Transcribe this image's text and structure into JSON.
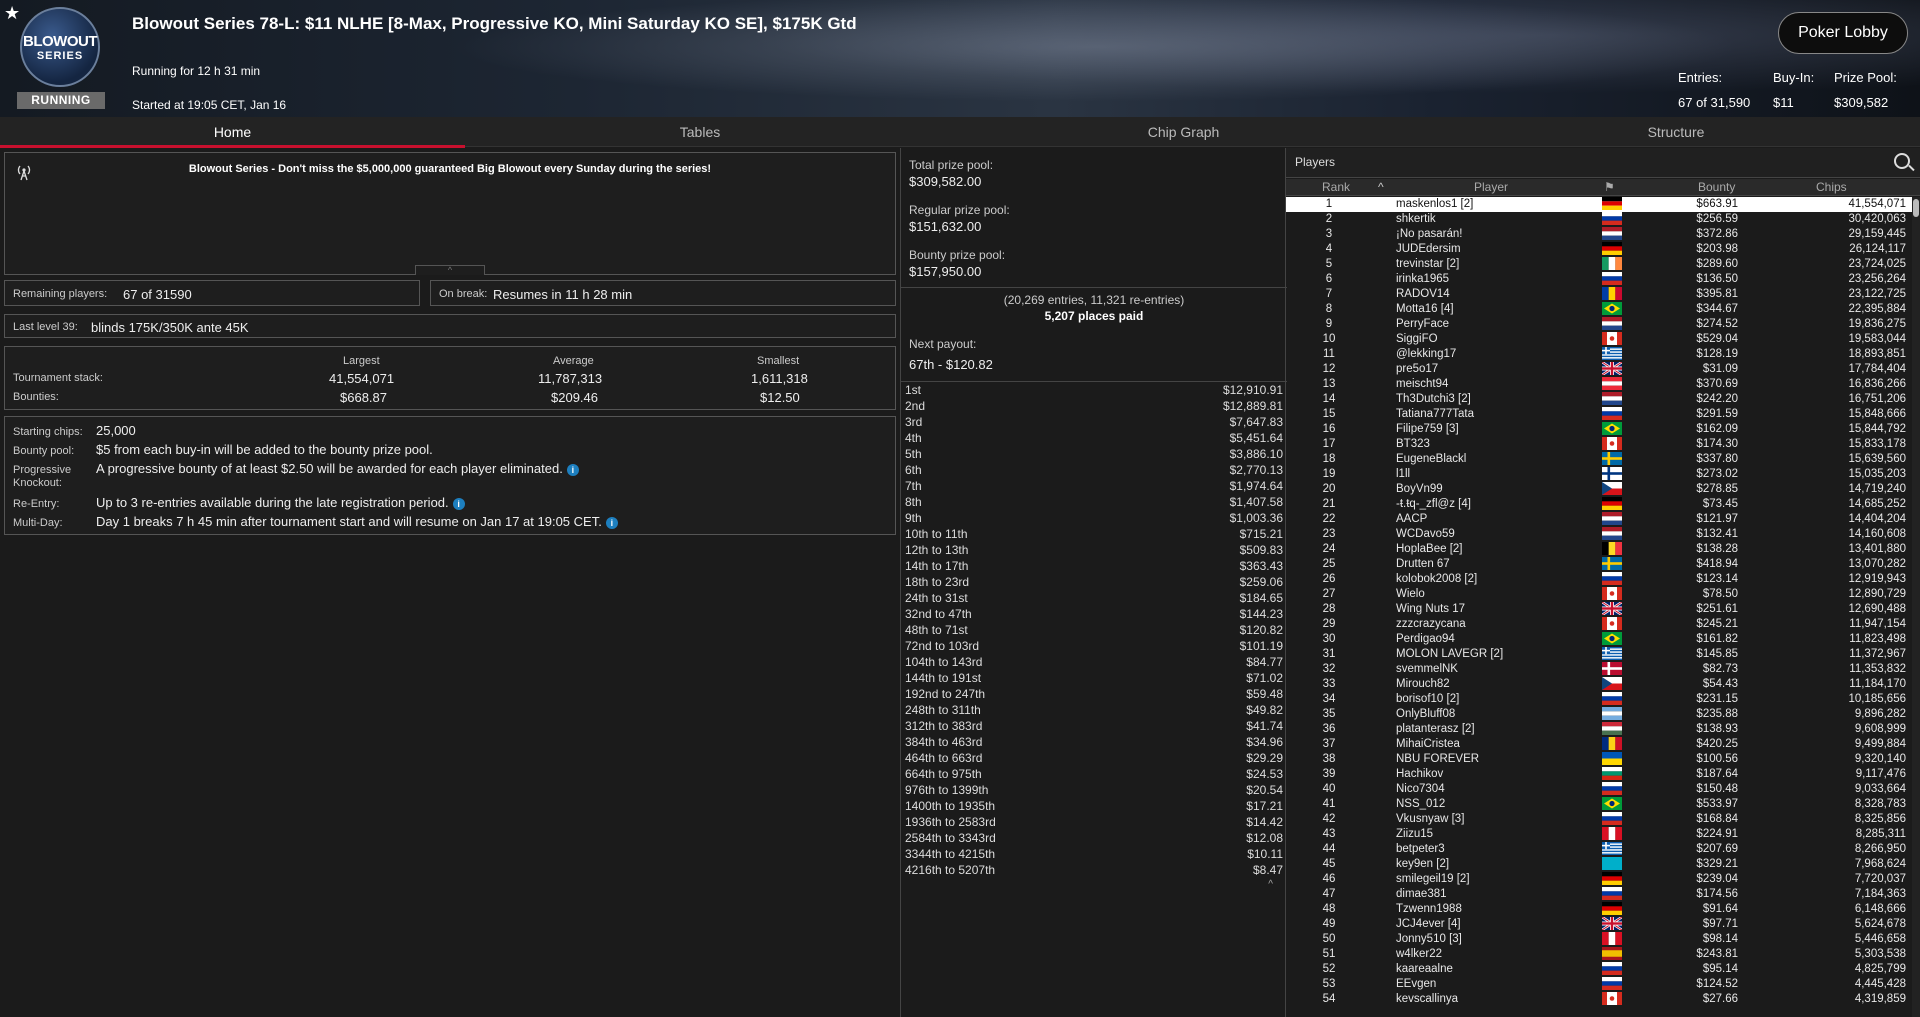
{
  "header": {
    "logo_line1": "BLOWOUT",
    "logo_line2": "SERIES",
    "status_badge": "RUNNING",
    "title": "Blowout Series 78-L: $11 NLHE [8-Max, Progressive KO, Mini Saturday KO SE], $175K Gtd",
    "running_for": "Running for 12 h 31 min",
    "started_at": "Started at 19:05 CET, Jan 16",
    "lobby_button": "Poker Lobby",
    "entries_label": "Entries:",
    "entries_value": "67 of 31,590",
    "buyin_label": "Buy-In:",
    "buyin_value": "$11",
    "prizepool_label": "Prize Pool:",
    "prizepool_value": "$309,582"
  },
  "tabs": [
    {
      "label": "Home"
    },
    {
      "label": "Tables"
    },
    {
      "label": "Chip Graph"
    },
    {
      "label": "Structure"
    }
  ],
  "home": {
    "announcement": "Blowout Series - Don't miss the $5,000,000 guaranteed Big Blowout every Sunday during the series!",
    "remaining_label": "Remaining players:",
    "remaining_value": "67 of 31590",
    "break_label": "On break:",
    "break_value": "Resumes in 11 h 28 min",
    "last_level_label": "Last level 39:",
    "last_level_value": "blinds 175K/350K ante 45K",
    "stack_headers": {
      "largest": "Largest",
      "average": "Average",
      "smallest": "Smallest"
    },
    "stack_label": "Tournament stack:",
    "stack_largest": "41,554,071",
    "stack_average": "11,787,313",
    "stack_smallest": "1,611,318",
    "bounties_label": "Bounties:",
    "bounty_largest": "$668.87",
    "bounty_average": "$209.46",
    "bounty_smallest": "$12.50",
    "info": {
      "starting_chips_label": "Starting chips:",
      "starting_chips": "25,000",
      "bounty_pool_label": "Bounty pool:",
      "bounty_pool": "$5 from each buy-in will be added to the bounty prize pool.",
      "pko_label1": "Progressive",
      "pko_label2": "Knockout:",
      "pko": "A progressive bounty of at least $2.50 will be awarded for each player eliminated.",
      "reentry_label": "Re-Entry:",
      "reentry": "Up to 3 re-entries available during the late registration period.",
      "multiday_label": "Multi-Day:",
      "multiday": "Day 1 breaks 7 h 45 min after tournament start and will resume on Jan 17 at 19:05 CET."
    }
  },
  "prizes": {
    "total_label": "Total prize pool:",
    "total_value": "$309,582.00",
    "regular_label": "Regular prize pool:",
    "regular_value": "$151,632.00",
    "bounty_label": "Bounty prize pool:",
    "bounty_value": "$157,950.00",
    "entries_note": "(20,269 entries, 11,321 re-entries)",
    "places_paid": "5,207 places paid",
    "next_payout_label": "Next payout:",
    "next_payout_value": "67th - $120.82",
    "payouts": [
      {
        "place": "1st",
        "amount": "$12,910.91"
      },
      {
        "place": "2nd",
        "amount": "$12,889.81"
      },
      {
        "place": "3rd",
        "amount": "$7,647.83"
      },
      {
        "place": "4th",
        "amount": "$5,451.64"
      },
      {
        "place": "5th",
        "amount": "$3,886.10"
      },
      {
        "place": "6th",
        "amount": "$2,770.13"
      },
      {
        "place": "7th",
        "amount": "$1,974.64"
      },
      {
        "place": "8th",
        "amount": "$1,407.58"
      },
      {
        "place": "9th",
        "amount": "$1,003.36"
      },
      {
        "place": "10th to 11th",
        "amount": "$715.21"
      },
      {
        "place": "12th to 13th",
        "amount": "$509.83"
      },
      {
        "place": "14th to 17th",
        "amount": "$363.43"
      },
      {
        "place": "18th to 23rd",
        "amount": "$259.06"
      },
      {
        "place": "24th to 31st",
        "amount": "$184.65"
      },
      {
        "place": "32nd to 47th",
        "amount": "$144.23"
      },
      {
        "place": "48th to 71st",
        "amount": "$120.82"
      },
      {
        "place": "72nd to 103rd",
        "amount": "$101.19"
      },
      {
        "place": "104th to 143rd",
        "amount": "$84.77"
      },
      {
        "place": "144th to 191st",
        "amount": "$71.02"
      },
      {
        "place": "192nd to 247th",
        "amount": "$59.48"
      },
      {
        "place": "248th to 311th",
        "amount": "$49.82"
      },
      {
        "place": "312th to 383rd",
        "amount": "$41.74"
      },
      {
        "place": "384th to 463rd",
        "amount": "$34.96"
      },
      {
        "place": "464th to 663rd",
        "amount": "$29.29"
      },
      {
        "place": "664th to 975th",
        "amount": "$24.53"
      },
      {
        "place": "976th to 1399th",
        "amount": "$20.54"
      },
      {
        "place": "1400th to 1935th",
        "amount": "$17.21"
      },
      {
        "place": "1936th to 2583rd",
        "amount": "$14.42"
      },
      {
        "place": "2584th to 3343rd",
        "amount": "$12.08"
      },
      {
        "place": "3344th to 4215th",
        "amount": "$10.11"
      },
      {
        "place": "4216th to 5207th",
        "amount": "$8.47"
      }
    ]
  },
  "players": {
    "title": "Players",
    "columns": {
      "rank": "Rank",
      "player": "Player",
      "bounty": "Bounty",
      "chips": "Chips"
    },
    "rows": [
      {
        "rank": "1",
        "name": "maskenlos1 [2]",
        "flag": "de",
        "bounty": "$663.91",
        "chips": "41,554,071"
      },
      {
        "rank": "2",
        "name": "shkertik",
        "flag": "ru",
        "bounty": "$256.59",
        "chips": "30,420,063"
      },
      {
        "rank": "3",
        "name": "¡No pasarán!",
        "flag": "nl",
        "bounty": "$372.86",
        "chips": "29,159,445"
      },
      {
        "rank": "4",
        "name": "JUDEdersim",
        "flag": "de",
        "bounty": "$203.98",
        "chips": "26,124,117"
      },
      {
        "rank": "5",
        "name": "trevinstar [2]",
        "flag": "ie",
        "bounty": "$289.60",
        "chips": "23,724,025"
      },
      {
        "rank": "6",
        "name": "irinka1965",
        "flag": "ru",
        "bounty": "$136.50",
        "chips": "23,256,264"
      },
      {
        "rank": "7",
        "name": "RADOV14",
        "flag": "md",
        "bounty": "$395.81",
        "chips": "23,122,725"
      },
      {
        "rank": "8",
        "name": "Motta16 [4]",
        "flag": "br",
        "bounty": "$344.67",
        "chips": "22,395,884"
      },
      {
        "rank": "9",
        "name": "PerryFace",
        "flag": "nl",
        "bounty": "$274.52",
        "chips": "19,836,275"
      },
      {
        "rank": "10",
        "name": "SiggiFO",
        "flag": "ca",
        "bounty": "$529.04",
        "chips": "19,583,044"
      },
      {
        "rank": "11",
        "name": "@lekking17",
        "flag": "gr",
        "bounty": "$128.19",
        "chips": "18,893,851"
      },
      {
        "rank": "12",
        "name": "pre5o17",
        "flag": "gb",
        "bounty": "$31.09",
        "chips": "17,784,404"
      },
      {
        "rank": "13",
        "name": "meischt94",
        "flag": "at",
        "bounty": "$370.69",
        "chips": "16,836,266"
      },
      {
        "rank": "14",
        "name": "Th3Dutchi3 [2]",
        "flag": "nl",
        "bounty": "$242.20",
        "chips": "16,751,206"
      },
      {
        "rank": "15",
        "name": "Tatiana777Tata",
        "flag": "ru",
        "bounty": "$291.59",
        "chips": "15,848,666"
      },
      {
        "rank": "16",
        "name": "Filipe759 [3]",
        "flag": "br",
        "bounty": "$162.09",
        "chips": "15,844,792"
      },
      {
        "rank": "17",
        "name": "BT323",
        "flag": "ca",
        "bounty": "$174.30",
        "chips": "15,833,178"
      },
      {
        "rank": "18",
        "name": "EugeneBlackl",
        "flag": "se",
        "bounty": "$337.80",
        "chips": "15,639,560"
      },
      {
        "rank": "19",
        "name": "l1ll",
        "flag": "fi",
        "bounty": "$273.02",
        "chips": "15,035,203"
      },
      {
        "rank": "20",
        "name": "BoyVn99",
        "flag": "cz",
        "bounty": "$278.85",
        "chips": "14,719,240"
      },
      {
        "rank": "21",
        "name": "-ŧ.ŧq-_zfl@z [4]",
        "flag": "de",
        "bounty": "$73.45",
        "chips": "14,685,252"
      },
      {
        "rank": "22",
        "name": "AACP",
        "flag": "nl",
        "bounty": "$121.97",
        "chips": "14,404,204"
      },
      {
        "rank": "23",
        "name": "WCDavo59",
        "flag": "nl",
        "bounty": "$132.41",
        "chips": "14,160,608"
      },
      {
        "rank": "24",
        "name": "HoplaBee [2]",
        "flag": "be",
        "bounty": "$138.28",
        "chips": "13,401,880"
      },
      {
        "rank": "25",
        "name": "Drutten 67",
        "flag": "se",
        "bounty": "$418.94",
        "chips": "13,070,282"
      },
      {
        "rank": "26",
        "name": "kolobok2008 [2]",
        "flag": "ru",
        "bounty": "$123.14",
        "chips": "12,919,943"
      },
      {
        "rank": "27",
        "name": "Wielo",
        "flag": "ca",
        "bounty": "$78.50",
        "chips": "12,890,729"
      },
      {
        "rank": "28",
        "name": "Wing Nuts 17",
        "flag": "gb",
        "bounty": "$251.61",
        "chips": "12,690,488"
      },
      {
        "rank": "29",
        "name": "zzzcrazycana",
        "flag": "ca",
        "bounty": "$245.21",
        "chips": "11,947,154"
      },
      {
        "rank": "30",
        "name": "Perdigao94",
        "flag": "br",
        "bounty": "$161.82",
        "chips": "11,823,498"
      },
      {
        "rank": "31",
        "name": "MOLON LAVEGR [2]",
        "flag": "gr",
        "bounty": "$145.85",
        "chips": "11,372,967"
      },
      {
        "rank": "32",
        "name": "svemmelNK",
        "flag": "no",
        "bounty": "$82.73",
        "chips": "11,353,832"
      },
      {
        "rank": "33",
        "name": "Mirouch82",
        "flag": "cz",
        "bounty": "$54.43",
        "chips": "11,184,170"
      },
      {
        "rank": "34",
        "name": "borisof10 [2]",
        "flag": "ru",
        "bounty": "$231.15",
        "chips": "10,185,656"
      },
      {
        "rank": "35",
        "name": "OnlyBluff08",
        "flag": "ar",
        "bounty": "$235.88",
        "chips": "9,896,282"
      },
      {
        "rank": "36",
        "name": "platanterasz [2]",
        "flag": "hu",
        "bounty": "$138.93",
        "chips": "9,608,999"
      },
      {
        "rank": "37",
        "name": "MihaiCristea",
        "flag": "ro",
        "bounty": "$420.25",
        "chips": "9,499,884"
      },
      {
        "rank": "38",
        "name": "NBU FOREVER",
        "flag": "ua",
        "bounty": "$100.56",
        "chips": "9,320,140"
      },
      {
        "rank": "39",
        "name": "Hachikov",
        "flag": "bg",
        "bounty": "$187.64",
        "chips": "9,117,476"
      },
      {
        "rank": "40",
        "name": "Nico7304",
        "flag": "ru",
        "bounty": "$150.48",
        "chips": "9,033,664"
      },
      {
        "rank": "41",
        "name": "NSS_012",
        "flag": "br",
        "bounty": "$533.97",
        "chips": "8,328,783"
      },
      {
        "rank": "42",
        "name": "Vkusnyaw [3]",
        "flag": "ru",
        "bounty": "$168.84",
        "chips": "8,325,856"
      },
      {
        "rank": "43",
        "name": "Ziizu15",
        "flag": "pe",
        "bounty": "$224.91",
        "chips": "8,285,311"
      },
      {
        "rank": "44",
        "name": "betpeter3",
        "flag": "gr",
        "bounty": "$207.69",
        "chips": "8,266,950"
      },
      {
        "rank": "45",
        "name": "key9en [2]",
        "flag": "kz",
        "bounty": "$329.21",
        "chips": "7,968,624"
      },
      {
        "rank": "46",
        "name": "smilegeil19 [2]",
        "flag": "de",
        "bounty": "$239.04",
        "chips": "7,720,037"
      },
      {
        "rank": "47",
        "name": "dimae381",
        "flag": "ru",
        "bounty": "$174.56",
        "chips": "7,184,363"
      },
      {
        "rank": "48",
        "name": "Tzwenn1988",
        "flag": "de",
        "bounty": "$91.64",
        "chips": "6,148,666"
      },
      {
        "rank": "49",
        "name": "JCJ4ever [4]",
        "flag": "gb",
        "bounty": "$97.71",
        "chips": "5,624,678"
      },
      {
        "rank": "50",
        "name": "Jonny510 [3]",
        "flag": "pe",
        "bounty": "$98.14",
        "chips": "5,446,658"
      },
      {
        "rank": "51",
        "name": "w4lker22",
        "flag": "es",
        "bounty": "$243.81",
        "chips": "5,303,538"
      },
      {
        "rank": "52",
        "name": "kaareaalne",
        "flag": "ru",
        "bounty": "$95.14",
        "chips": "4,825,799"
      },
      {
        "rank": "53",
        "name": "EEvgen",
        "flag": "ru",
        "bounty": "$124.52",
        "chips": "4,445,428"
      },
      {
        "rank": "54",
        "name": "kevscallinya",
        "flag": "ca",
        "bounty": "$27.66",
        "chips": "4,319,859"
      }
    ]
  },
  "colors": {
    "accent": "#c8102e",
    "highlight_row": "#ffffff",
    "info_icon": "#1d7fbf"
  }
}
